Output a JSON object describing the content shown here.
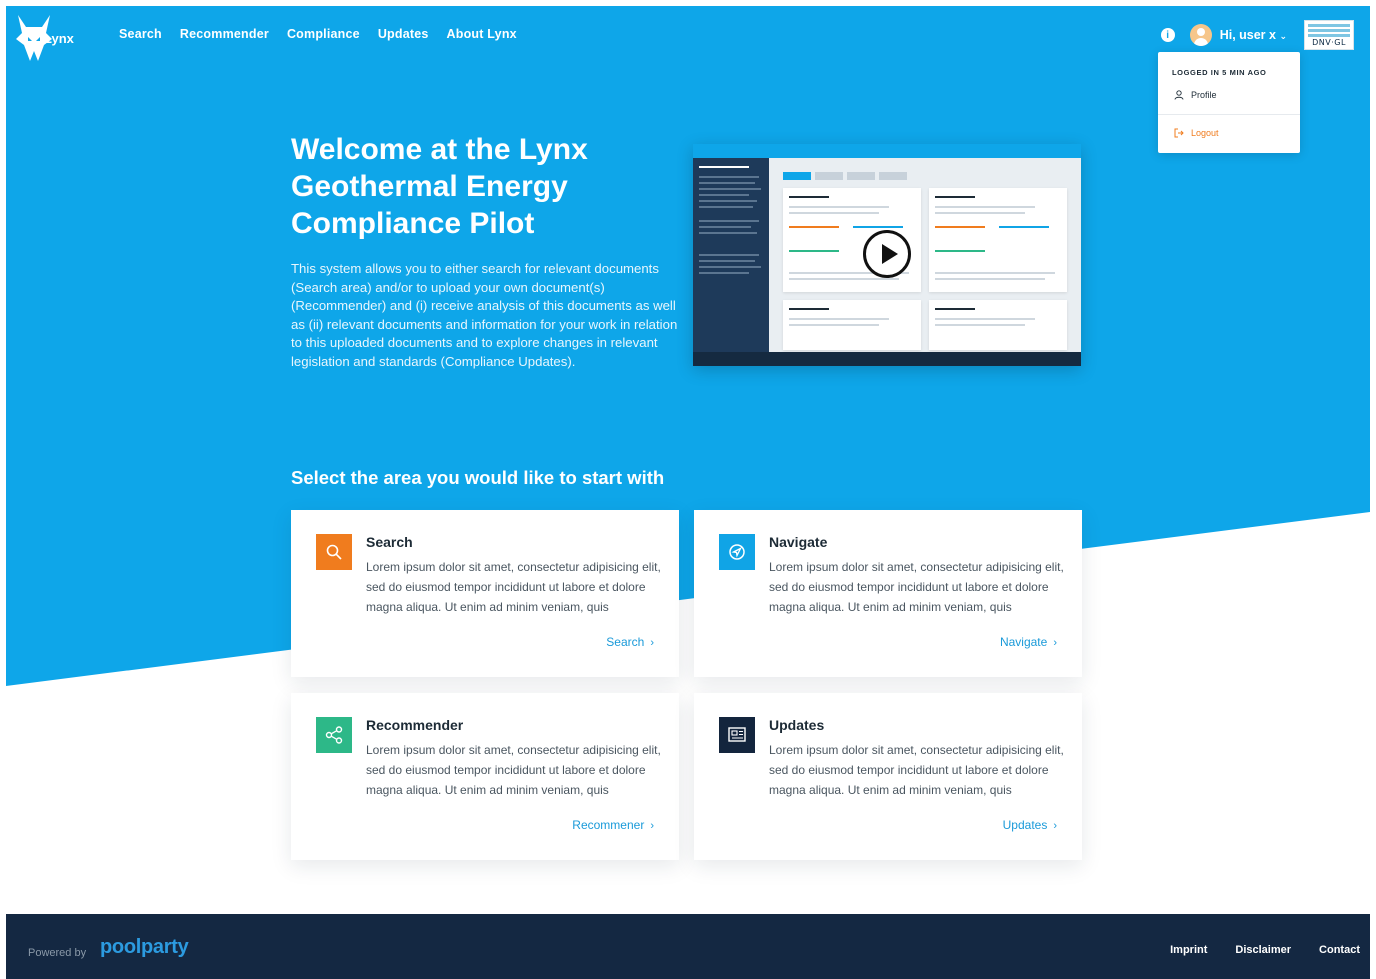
{
  "app": {
    "logo_text": "Lynx"
  },
  "nav": {
    "items": [
      "Search",
      "Recommender",
      "Compliance",
      "Updates",
      "About Lynx"
    ],
    "user_greeting": "Hi, user x",
    "info_icon": "info-icon",
    "brand_badge": "DNV·GL"
  },
  "dropdown": {
    "header": "LOGGED IN 5 MIN AGO",
    "profile_label": "Profile",
    "logout_label": "Logout"
  },
  "hero": {
    "title_lines": [
      "Welcome at the Lynx",
      "Geothermal Energy",
      "Compliance Pilot"
    ],
    "description": "This system allows you to either search for relevant documents (Search area) and/or to upload your own document(s) (Recommender) and (i) receive analysis of this documents as well as (ii) relevant documents and information for your work in relation to this uploaded documents and to explore changes in relevant legislation and standards (Compliance Updates)."
  },
  "section": {
    "title": "Select the area you would like to start with"
  },
  "cards": [
    {
      "title": "Search",
      "desc": "Lorem ipsum dolor sit amet, consectetur adipisicing elit, sed do eiusmod tempor incididunt ut labore et dolore magna aliqua. Ut enim ad minim veniam, quis",
      "link": "Search",
      "icon": "search-icon",
      "color": "#f07c1e"
    },
    {
      "title": "Navigate",
      "desc": "Lorem ipsum dolor sit amet, consectetur adipisicing elit, sed do eiusmod tempor incididunt ut labore et dolore magna aliqua. Ut enim ad minim veniam, quis",
      "link": "Navigate",
      "icon": "navigate-icon",
      "color": "#10a4e6"
    },
    {
      "title": "Recommender",
      "desc": "Lorem ipsum dolor sit amet, consectetur adipisicing elit, sed do eiusmod tempor incididunt ut labore et dolore magna aliqua. Ut enim ad minim veniam, quis",
      "link": "Recommener",
      "icon": "share-icon",
      "color": "#2db888"
    },
    {
      "title": "Updates",
      "desc": "Lorem ipsum dolor sit amet, consectetur adipisicing elit, sed do eiusmod tempor incididunt ut labore et dolore magna aliqua. Ut enim ad minim veniam, quis",
      "link": "Updates",
      "icon": "newspaper-icon",
      "color": "#13253d"
    }
  ],
  "footer": {
    "powered_by": "Powered by",
    "brand": "poolparty",
    "links": [
      "Imprint",
      "Disclaimer",
      "Contact"
    ]
  },
  "colors": {
    "hero": "#0ea6e9",
    "footer": "#142842",
    "link": "#1a9ad9"
  }
}
